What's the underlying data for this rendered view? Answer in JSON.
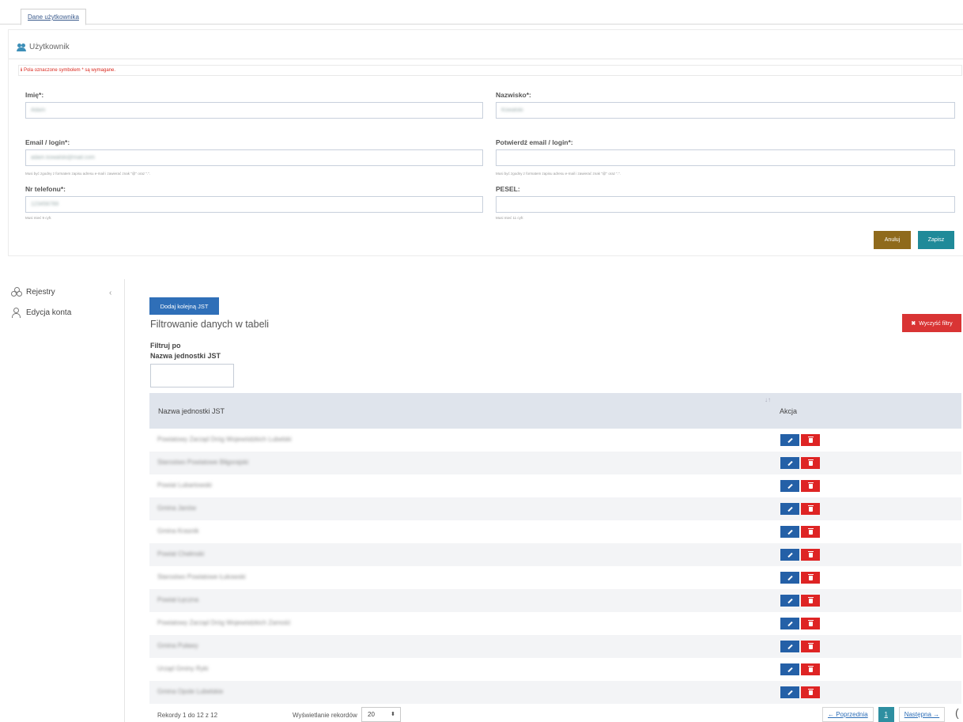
{
  "form": {
    "tab_label": "Dane użytkownika",
    "panel_title": "Użytkownik",
    "required_note": "Pola oznaczone symbolem * są wymagane.",
    "fields": {
      "first_name": {
        "label": "Imię*:",
        "value": "Adam"
      },
      "last_name": {
        "label": "Nazwisko*:",
        "value": "Kowalski"
      },
      "email": {
        "label": "Email / login*:",
        "value": "adam.kowalski@mail.com",
        "hint": "Musi być zgodny z formatem zapisu adresu e-mail i zawierać znak \"@\" oraz \".\"."
      },
      "email_confirm": {
        "label": "Potwierdź email / login*:",
        "value": "",
        "hint": "Musi być zgodny z formatem zapisu adresu e-mail i zawierać znak \"@\" oraz \".\"."
      },
      "phone": {
        "label": "Nr telefonu*:",
        "value": "123456789",
        "hint": "Musi mieć 9 cyfr."
      },
      "pesel": {
        "label": "PESEL:",
        "value": "",
        "hint": "Musi mieć 11 cyfr."
      }
    },
    "cancel_label": "Anuluj",
    "save_label": "Zapisz"
  },
  "sidebar": {
    "items": [
      {
        "label": "Rejestry",
        "icon": "registry-icon"
      },
      {
        "label": "Edycja konta",
        "icon": "user-icon"
      }
    ],
    "collapse_glyph": "‹"
  },
  "main": {
    "add_label": "Dodaj kolejną JST",
    "filter_heading": "Filtrowanie danych w tabeli",
    "clear_label": "Wyczyść filtry",
    "clear_glyph": "✖",
    "filter_by": "Filtruj po",
    "filter_field": "Nazwa jednostki JST",
    "table": {
      "col_name": "Nazwa jednostki JST",
      "col_action": "Akcja",
      "sort_glyph": "↓↑",
      "rows": [
        "Powiatowy Zarząd Dróg Wojewódzkich Lubelski",
        "Starostwo Powiatowe Biłgorajski",
        "Powiat Lubartowski",
        "Gmina Janów",
        "Gmina Krasnik",
        "Powiat Chełmski",
        "Starostwo Powiatowe Łukowski",
        "Powiat Łęczna",
        "Powiatowy Zarząd Dróg Wojewódzkich Zamość",
        "Gmina Puławy",
        "Urząd Gminy Ryki",
        "Gmina Opole Lubelskie"
      ]
    },
    "records_info": "Rekordy 1 do 12 z 12",
    "page_size_label": "Wyświetlanie rekordów",
    "page_size_value": "20",
    "prev_label": "← Poprzednia",
    "current_page": "1",
    "next_label": "Następna →",
    "edge_glyph": "("
  }
}
